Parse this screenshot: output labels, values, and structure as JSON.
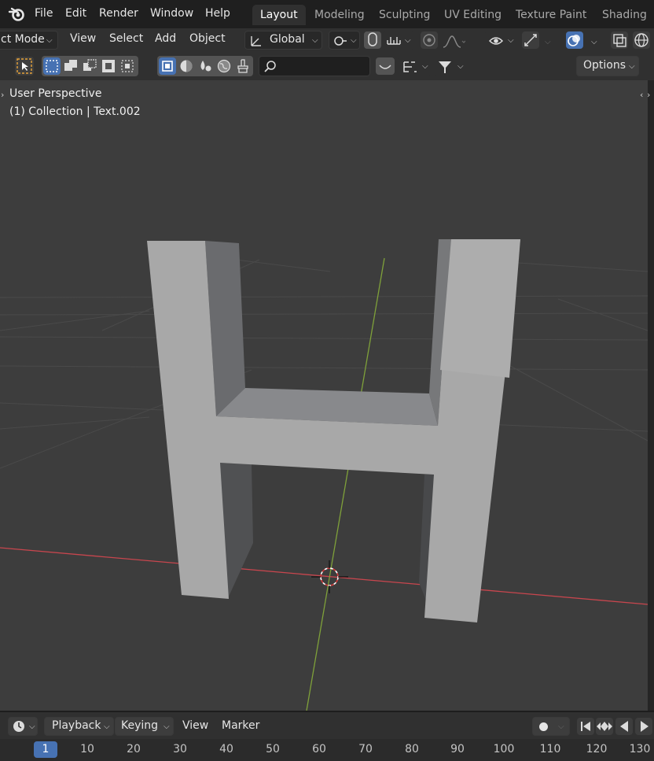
{
  "menu": {
    "items": [
      "File",
      "Edit",
      "Render",
      "Window",
      "Help"
    ]
  },
  "workspaces": {
    "tabs": [
      "Layout",
      "Modeling",
      "Sculpting",
      "UV Editing",
      "Texture Paint",
      "Shading"
    ],
    "active": "Layout"
  },
  "header": {
    "mode": "ct Mode",
    "view": "View",
    "select": "Select",
    "add": "Add",
    "object": "Object",
    "orientation": "Global",
    "options": "Options",
    "search_placeholder": ""
  },
  "viewport": {
    "perspective": "User Perspective",
    "collection": "(1) Collection | Text.002",
    "colors": {
      "background": "#3d3d3d",
      "object": "#a8a8a8",
      "x_axis": "#c8464e",
      "y_axis": "#7fa13a"
    }
  },
  "timeline": {
    "playback": "Playback",
    "keying": "Keying",
    "view": "View",
    "marker": "Marker",
    "current_frame": "1",
    "frames": [
      "10",
      "20",
      "30",
      "40",
      "50",
      "60",
      "70",
      "80",
      "90",
      "100",
      "110",
      "120",
      "130"
    ]
  },
  "accent": "#4772b3"
}
